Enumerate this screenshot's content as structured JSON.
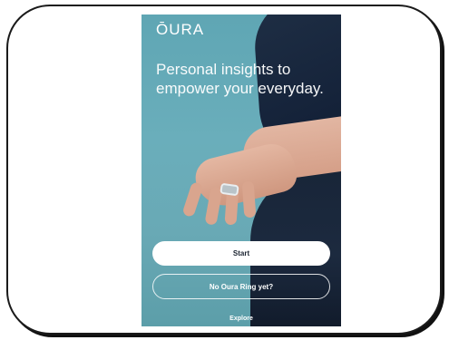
{
  "app": {
    "logo_text": "ŌURA",
    "headline": "Personal insights to empower your everyday."
  },
  "actions": {
    "start_label": "Start",
    "no_ring_label": "No Oura Ring yet?",
    "explore_label": "Explore"
  },
  "colors": {
    "background_teal": "#6aaebb",
    "sleeve_navy": "#15233a",
    "button_white": "#ffffff",
    "button_text": "#1a2330"
  },
  "image": {
    "description_icon": "hand-with-ring-photo"
  }
}
